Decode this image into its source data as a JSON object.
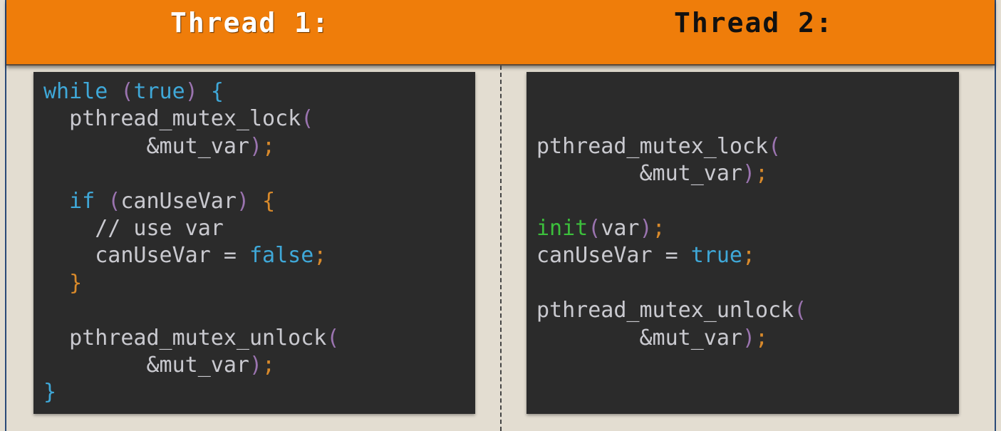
{
  "header": {
    "thread1_title": "Thread 1:",
    "thread2_title": "Thread 2:",
    "background_color": "#ef7d0a"
  },
  "code_colors": {
    "panel_bg": "#2b2b2b",
    "plain": "#c9c9cf",
    "keyword": "#3fa8d8",
    "paren": "#9b74b0",
    "punct": "#d98a2b",
    "function": "#3cbf3c"
  },
  "thread1_code": {
    "lines": [
      [
        {
          "t": "while",
          "c": "kw"
        },
        {
          "t": " ",
          "c": "pl"
        },
        {
          "t": "(",
          "c": "par"
        },
        {
          "t": "true",
          "c": "kw"
        },
        {
          "t": ")",
          "c": "par"
        },
        {
          "t": " ",
          "c": "pl"
        },
        {
          "t": "{",
          "c": "kw"
        }
      ],
      [
        {
          "t": "  pthread_mutex_lock",
          "c": "pl"
        },
        {
          "t": "(",
          "c": "par"
        }
      ],
      [
        {
          "t": "        &mut_var",
          "c": "pl"
        },
        {
          "t": ")",
          "c": "par"
        },
        {
          "t": ";",
          "c": "orn"
        }
      ],
      [],
      [
        {
          "t": "  if ",
          "c": "kw"
        },
        {
          "t": "(",
          "c": "par"
        },
        {
          "t": "canUseVar",
          "c": "pl"
        },
        {
          "t": ")",
          "c": "par"
        },
        {
          "t": " ",
          "c": "pl"
        },
        {
          "t": "{",
          "c": "orn"
        }
      ],
      [
        {
          "t": "    // use var",
          "c": "pl"
        }
      ],
      [
        {
          "t": "    canUseVar = ",
          "c": "pl"
        },
        {
          "t": "false",
          "c": "kw"
        },
        {
          "t": ";",
          "c": "orn"
        }
      ],
      [
        {
          "t": "  }",
          "c": "orn"
        }
      ],
      [],
      [
        {
          "t": "  pthread_mutex_unlock",
          "c": "pl"
        },
        {
          "t": "(",
          "c": "par"
        }
      ],
      [
        {
          "t": "        &mut_var",
          "c": "pl"
        },
        {
          "t": ")",
          "c": "par"
        },
        {
          "t": ";",
          "c": "orn"
        }
      ],
      [
        {
          "t": "}",
          "c": "kw"
        }
      ]
    ]
  },
  "thread2_code": {
    "lines": [
      [],
      [],
      [
        {
          "t": "pthread_mutex_lock",
          "c": "pl"
        },
        {
          "t": "(",
          "c": "par"
        }
      ],
      [
        {
          "t": "        &mut_var",
          "c": "pl"
        },
        {
          "t": ")",
          "c": "par"
        },
        {
          "t": ";",
          "c": "orn"
        }
      ],
      [],
      [
        {
          "t": "init",
          "c": "grn"
        },
        {
          "t": "(",
          "c": "par"
        },
        {
          "t": "var",
          "c": "pl"
        },
        {
          "t": ")",
          "c": "par"
        },
        {
          "t": ";",
          "c": "orn"
        }
      ],
      [
        {
          "t": "canUseVar = ",
          "c": "pl"
        },
        {
          "t": "true",
          "c": "kw"
        },
        {
          "t": ";",
          "c": "orn"
        }
      ],
      [],
      [
        {
          "t": "pthread_mutex_unlock",
          "c": "pl"
        },
        {
          "t": "(",
          "c": "par"
        }
      ],
      [
        {
          "t": "        &mut_var",
          "c": "pl"
        },
        {
          "t": ")",
          "c": "par"
        },
        {
          "t": ";",
          "c": "orn"
        }
      ]
    ]
  }
}
